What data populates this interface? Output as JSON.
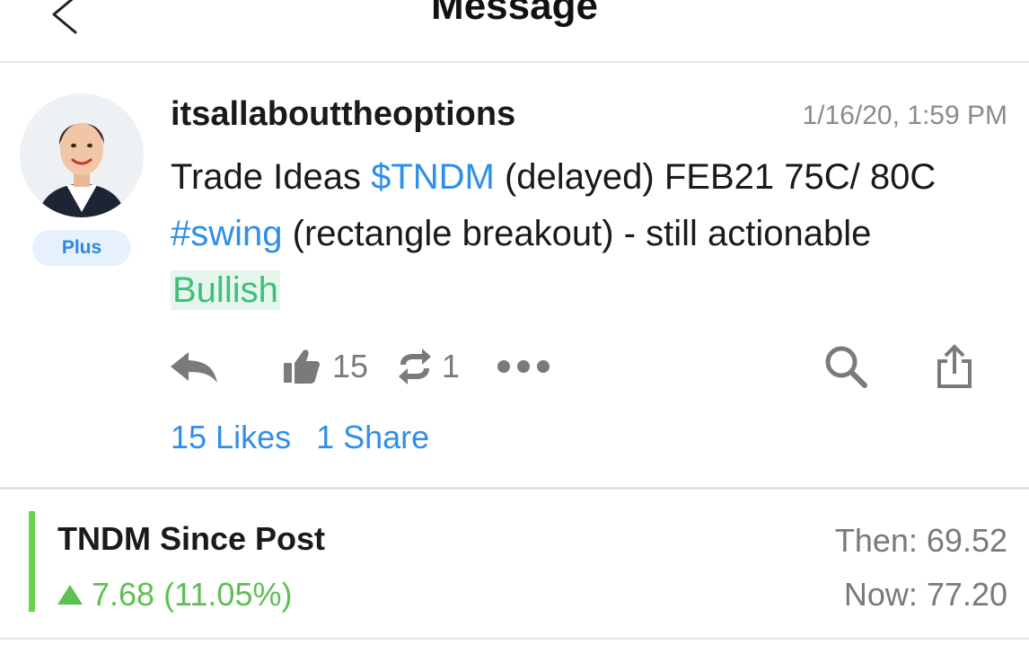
{
  "header": {
    "title": "Message",
    "back_icon": "chevron-left-icon"
  },
  "post": {
    "username": "itsallabouttheoptions",
    "badge": "Plus",
    "timestamp": "1/16/20, 1:59 PM",
    "body": {
      "part1": "Trade Ideas ",
      "cashtag": "$TNDM",
      "part2": " (delayed) FEB21 75C/ 80C ",
      "hashtag": "#swing",
      "part3": " (rectangle breakout) - still actionable ",
      "sentiment": "Bullish"
    },
    "actions": {
      "reply_icon": "reply-icon",
      "like_icon": "thumbs-up-icon",
      "like_count": "15",
      "reshare_icon": "reshare-icon",
      "reshare_count": "1",
      "more_icon": "more-icon",
      "search_icon": "search-icon",
      "share_icon": "share-icon"
    },
    "links": {
      "likes": "15 Likes",
      "shares": "1 Share"
    }
  },
  "performance": {
    "title": "TNDM Since Post",
    "change": "7.68 (11.05%)",
    "then": "Then: 69.52",
    "now": "Now: 77.20"
  },
  "colors": {
    "link_blue": "#2f8fe8",
    "bullish_green": "#3fbf7a",
    "gain_green": "#5cc150",
    "muted_gray": "#7a7a7a"
  }
}
